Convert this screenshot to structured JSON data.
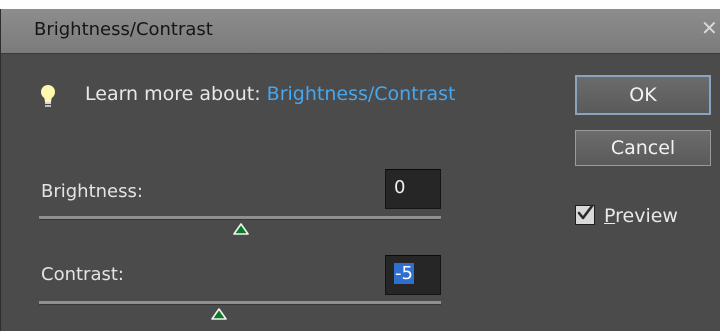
{
  "dialog": {
    "title": "Brightness/Contrast",
    "close_icon": "close-icon"
  },
  "learn": {
    "prefix": "Learn more about:",
    "link": "Brightness/Contrast",
    "icon": "lightbulb-icon",
    "link_color": "#47a7ee"
  },
  "brightness": {
    "label": "Brightness:",
    "value": "0"
  },
  "contrast": {
    "label": "Contrast:",
    "value": "-5"
  },
  "buttons": {
    "ok": "OK",
    "cancel": "Cancel"
  },
  "preview": {
    "label_first": "P",
    "label_rest": "review",
    "checked": true
  }
}
